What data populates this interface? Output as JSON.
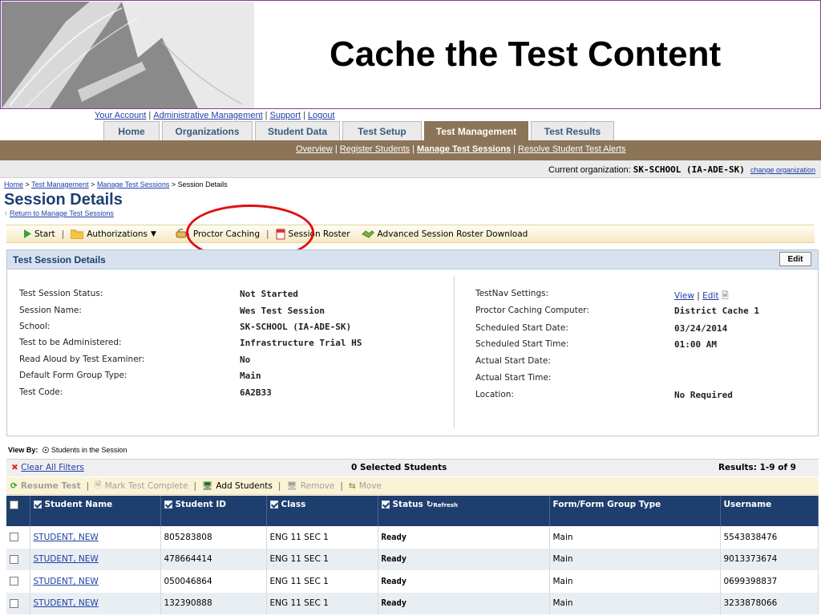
{
  "slide": {
    "title": "Cache the Test Content"
  },
  "top_links": [
    "Your Account",
    "Administrative Management",
    "Support",
    "Logout"
  ],
  "main_tabs": [
    {
      "label": "Home",
      "active": false
    },
    {
      "label": "Organizations",
      "active": false
    },
    {
      "label": "Student Data",
      "active": false
    },
    {
      "label": "Test Setup",
      "active": false
    },
    {
      "label": "Test Management",
      "active": true
    },
    {
      "label": "Test Results",
      "active": false
    }
  ],
  "sub_nav": [
    {
      "label": "Overview",
      "current": false
    },
    {
      "label": "Register Students",
      "current": false
    },
    {
      "label": "Manage Test Sessions",
      "current": true
    },
    {
      "label": "Resolve Student Test Alerts",
      "current": false
    }
  ],
  "org": {
    "label": "Current organization:",
    "value": "SK-SCHOOL (IA-ADE-SK)",
    "change": "change organization"
  },
  "breadcrumb": [
    "Home",
    "Test Management",
    "Manage Test Sessions",
    "Session Details"
  ],
  "page": {
    "title": "Session Details",
    "return_link": "Return to Manage Test Sessions"
  },
  "toolbar": {
    "start": "Start",
    "authorizations": "Authorizations",
    "proctor_caching": "Proctor Caching",
    "session_roster": "Session Roster",
    "advanced_roster": "Advanced Session Roster Download"
  },
  "details": {
    "header": "Test Session Details",
    "edit": "Edit",
    "left": [
      {
        "label": "Test Session Status:",
        "value": "Not Started"
      },
      {
        "label": "Session Name:",
        "value": "Wes Test Session"
      },
      {
        "label": "School:",
        "value": "SK-SCHOOL (IA-ADE-SK)"
      },
      {
        "label": "Test to be Administered:",
        "value": "Infrastructure Trial HS"
      },
      {
        "label": "Read Aloud by Test Examiner:",
        "value": "No"
      },
      {
        "label": "Default Form Group Type:",
        "value": "Main"
      },
      {
        "label": "Test Code:",
        "value": "6A2B33"
      }
    ],
    "right": [
      {
        "label": "TestNav Settings:",
        "view": "View",
        "edit": "Edit"
      },
      {
        "label": "Proctor Caching Computer:",
        "value": "District Cache 1"
      },
      {
        "label": "Scheduled Start Date:",
        "value": "03/24/2014"
      },
      {
        "label": "Scheduled Start Time:",
        "value": "01:00 AM"
      },
      {
        "label": "Actual Start Date:",
        "value": ""
      },
      {
        "label": "Actual Start Time:",
        "value": ""
      },
      {
        "label": "Location:",
        "value": "No Required"
      }
    ]
  },
  "students": {
    "view_by_label": "View By:",
    "view_by_option": "Students in the Session",
    "clear_filters": "Clear All Filters",
    "selected": "0 Selected Students",
    "results": "Results: 1-9 of 9",
    "actions": {
      "resume": "Resume Test",
      "mark_complete": "Mark Test Complete",
      "add": "Add Students",
      "remove": "Remove",
      "move": "Move"
    },
    "columns": [
      "Student Name",
      "Student ID",
      "Class",
      "Status",
      "Form/Form Group Type",
      "Username"
    ],
    "refresh_label": "Refresh",
    "rows": [
      {
        "name": "STUDENT, NEW",
        "id": "805283808",
        "class": "ENG 11 SEC 1",
        "status": "Ready",
        "form": "Main",
        "username": "5543838476"
      },
      {
        "name": "STUDENT, NEW",
        "id": "478664414",
        "class": "ENG 11 SEC 1",
        "status": "Ready",
        "form": "Main",
        "username": "9013373674"
      },
      {
        "name": "STUDENT, NEW",
        "id": "050046864",
        "class": "ENG 11 SEC 1",
        "status": "Ready",
        "form": "Main",
        "username": "0699398837"
      },
      {
        "name": "STUDENT, NEW",
        "id": "132390888",
        "class": "ENG 11 SEC 1",
        "status": "Ready",
        "form": "Main",
        "username": "3233878066"
      }
    ]
  }
}
